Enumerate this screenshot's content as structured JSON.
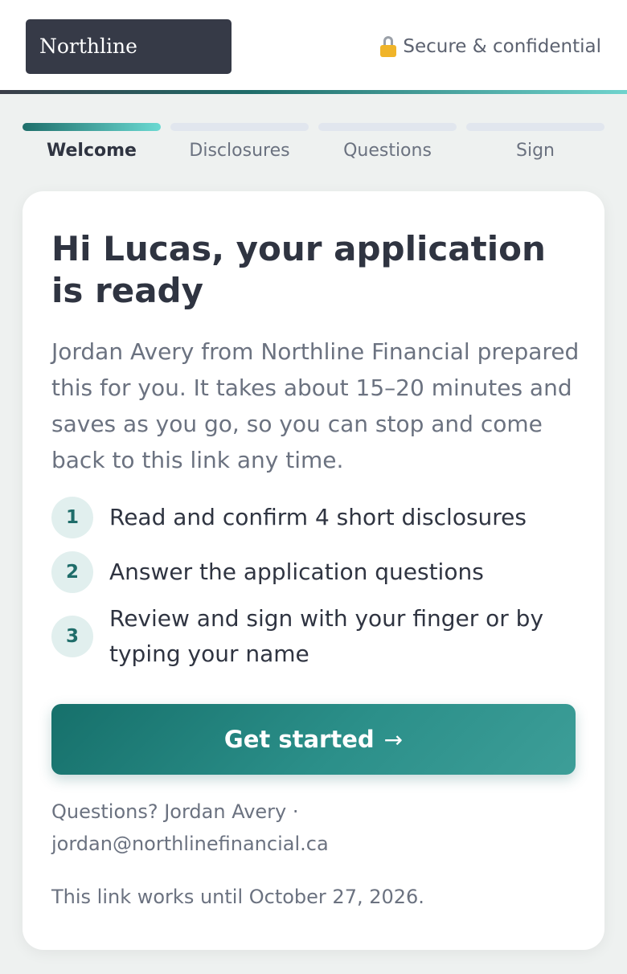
{
  "header": {
    "brand": "Northline",
    "secure_label": "Secure & confidential"
  },
  "progress": {
    "steps": [
      {
        "label": "Welcome",
        "active": true
      },
      {
        "label": "Disclosures",
        "active": false
      },
      {
        "label": "Questions",
        "active": false
      },
      {
        "label": "Sign",
        "active": false
      }
    ]
  },
  "card": {
    "title": "Hi Lucas, your application is ready",
    "intro": "Jordan Avery from Northline Financial prepared this for you. It takes about 15–20 minutes and saves as you go, so you can stop and come back to this link any time.",
    "tasks": [
      {
        "num": "1",
        "text": "Read and confirm 4 short disclosures"
      },
      {
        "num": "2",
        "text": "Answer the application questions"
      },
      {
        "num": "3",
        "text": "Review and sign with your finger or by typing your name"
      }
    ],
    "cta_label": "Get started",
    "cta_arrow": "→",
    "contact_prefix": "Questions? Jordan Avery ·",
    "contact_email": "jordan@northlinefinancial.ca",
    "expiry": "This link works until October 27, 2026."
  },
  "colors": {
    "brand_dark": "#363a47",
    "accent_teal": "#1f6d6a",
    "accent_light": "#6ad9d2",
    "background": "#eef1f0"
  },
  "icons": {
    "secure": "lock-icon",
    "cta": "arrow-right-icon"
  }
}
